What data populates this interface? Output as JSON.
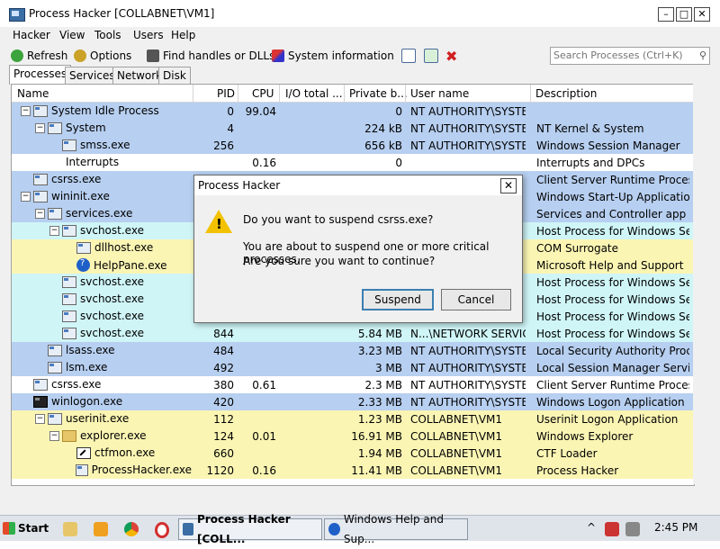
{
  "window": {
    "title": "Process Hacker [COLLABNET\\VM1]",
    "min": "–",
    "max": "□",
    "close": "✕"
  },
  "menu": [
    "Hacker",
    "View",
    "Tools",
    "Users",
    "Help"
  ],
  "toolbar": {
    "refresh": "Refresh",
    "options": "Options",
    "find": "Find handles or DLLs",
    "sysinfo": "System information"
  },
  "search": {
    "placeholder": "Search Processes (Ctrl+K)",
    "icon": "search-icon"
  },
  "tabs": [
    "Processes",
    "Services",
    "Network",
    "Disk"
  ],
  "columns": [
    "Name",
    "PID",
    "CPU",
    "I/O total ...",
    "Private b...",
    "User name",
    "Description"
  ],
  "colors": {
    "blue": "#b7cff0",
    "cyan": "#cff5f7",
    "yellow": "#fbf5b4",
    "white": "#ffffff",
    "accent": "#3c7fb1"
  },
  "processes": [
    {
      "indent": 0,
      "expander": "−",
      "icon": "process-icon",
      "name": "System Idle Process",
      "pid": "0",
      "cpu": "99.04",
      "io": "",
      "priv": "0",
      "user": "NT AUTHORITY\\SYSTEM",
      "desc": "",
      "color": "blue"
    },
    {
      "indent": 1,
      "expander": "−",
      "icon": "process-icon",
      "name": "System",
      "pid": "4",
      "cpu": "",
      "io": "",
      "priv": "224 kB",
      "user": "NT AUTHORITY\\SYSTEM",
      "desc": "NT Kernel & System",
      "color": "blue"
    },
    {
      "indent": 2,
      "expander": "",
      "icon": "process-icon",
      "name": "smss.exe",
      "pid": "256",
      "cpu": "",
      "io": "",
      "priv": "656 kB",
      "user": "NT AUTHORITY\\SYSTEM",
      "desc": "Windows Session Manager",
      "color": "blue"
    },
    {
      "indent": 1,
      "expander": "",
      "icon": "",
      "name": "Interrupts",
      "pid": "",
      "cpu": "0.16",
      "io": "",
      "priv": "0",
      "user": "",
      "desc": "Interrupts and DPCs",
      "color": "white"
    },
    {
      "indent": 0,
      "expander": "",
      "icon": "process-icon",
      "name": "csrss.exe",
      "pid": "",
      "cpu": "",
      "io": "",
      "priv": "",
      "user": "",
      "desc": "Client Server Runtime Process",
      "color": "blue"
    },
    {
      "indent": 0,
      "expander": "−",
      "icon": "process-icon",
      "name": "wininit.exe",
      "pid": "",
      "cpu": "",
      "io": "",
      "priv": "",
      "user": "",
      "desc": "Windows Start-Up Application",
      "color": "blue"
    },
    {
      "indent": 1,
      "expander": "−",
      "icon": "process-icon",
      "name": "services.exe",
      "pid": "",
      "cpu": "",
      "io": "",
      "priv": "",
      "user": "",
      "desc": "Services and Controller app",
      "color": "blue"
    },
    {
      "indent": 2,
      "expander": "−",
      "icon": "process-icon",
      "name": "svchost.exe",
      "pid": "",
      "cpu": "",
      "io": "",
      "priv": "",
      "user": "",
      "desc": "Host Process for Windows Ser...",
      "color": "cyan"
    },
    {
      "indent": 3,
      "expander": "",
      "icon": "process-icon",
      "name": "dllhost.exe",
      "pid": "",
      "cpu": "",
      "io": "",
      "priv": "",
      "user": "",
      "desc": "COM Surrogate",
      "color": "yellow"
    },
    {
      "indent": 3,
      "expander": "",
      "icon": "help-icon",
      "name": "HelpPane.exe",
      "pid": "",
      "cpu": "",
      "io": "",
      "priv": "",
      "user": "",
      "desc": "Microsoft Help and Support",
      "color": "yellow"
    },
    {
      "indent": 2,
      "expander": "",
      "icon": "process-icon",
      "name": "svchost.exe",
      "pid": "",
      "cpu": "",
      "io": "",
      "priv": "",
      "user": "",
      "desc": "Host Process for Windows Ser...",
      "color": "cyan"
    },
    {
      "indent": 2,
      "expander": "",
      "icon": "process-icon",
      "name": "svchost.exe",
      "pid": "",
      "cpu": "",
      "io": "",
      "priv": "",
      "user": "",
      "desc": "Host Process for Windows Ser...",
      "color": "cyan"
    },
    {
      "indent": 2,
      "expander": "",
      "icon": "process-icon",
      "name": "svchost.exe",
      "pid": "",
      "cpu": "",
      "io": "",
      "priv": "",
      "user": "",
      "desc": "Host Process for Windows Ser...",
      "color": "cyan"
    },
    {
      "indent": 2,
      "expander": "",
      "icon": "process-icon",
      "name": "svchost.exe",
      "pid": "844",
      "cpu": "",
      "io": "",
      "priv": "5.84 MB",
      "user": "N...\\NETWORK SERVICE",
      "desc": "Host Process for Windows Ser...",
      "color": "cyan"
    },
    {
      "indent": 1,
      "expander": "",
      "icon": "process-icon",
      "name": "lsass.exe",
      "pid": "484",
      "cpu": "",
      "io": "",
      "priv": "3.23 MB",
      "user": "NT AUTHORITY\\SYSTEM",
      "desc": "Local Security Authority Proce...",
      "color": "blue"
    },
    {
      "indent": 1,
      "expander": "",
      "icon": "process-icon",
      "name": "lsm.exe",
      "pid": "492",
      "cpu": "",
      "io": "",
      "priv": "3 MB",
      "user": "NT AUTHORITY\\SYSTEM",
      "desc": "Local Session Manager Service",
      "color": "blue"
    },
    {
      "indent": 0,
      "expander": "",
      "icon": "process-icon",
      "name": "csrss.exe",
      "pid": "380",
      "cpu": "0.61",
      "io": "",
      "priv": "2.3 MB",
      "user": "NT AUTHORITY\\SYSTEM",
      "desc": "Client Server Runtime Process",
      "color": "white"
    },
    {
      "indent": 0,
      "expander": "",
      "icon": "logon-icon",
      "name": "winlogon.exe",
      "pid": "420",
      "cpu": "",
      "io": "",
      "priv": "2.33 MB",
      "user": "NT AUTHORITY\\SYSTEM",
      "desc": "Windows Logon Application",
      "color": "blue"
    },
    {
      "indent": 1,
      "expander": "−",
      "icon": "process-icon",
      "name": "userinit.exe",
      "pid": "112",
      "cpu": "",
      "io": "",
      "priv": "1.23 MB",
      "user": "COLLABNET\\VM1",
      "desc": "Userinit Logon Application",
      "color": "yellow"
    },
    {
      "indent": 2,
      "expander": "−",
      "icon": "folder-icon",
      "name": "explorer.exe",
      "pid": "124",
      "cpu": "0.01",
      "io": "",
      "priv": "16.91 MB",
      "user": "COLLABNET\\VM1",
      "desc": "Windows Explorer",
      "color": "yellow"
    },
    {
      "indent": 3,
      "expander": "",
      "icon": "pen-icon",
      "name": "ctfmon.exe",
      "pid": "660",
      "cpu": "",
      "io": "",
      "priv": "1.94 MB",
      "user": "COLLABNET\\VM1",
      "desc": "CTF Loader",
      "color": "yellow"
    },
    {
      "indent": 3,
      "expander": "",
      "icon": "process-icon",
      "name": "ProcessHacker.exe",
      "pid": "1120",
      "cpu": "0.16",
      "io": "",
      "priv": "11.41 MB",
      "user": "COLLABNET\\VM1",
      "desc": "Process Hacker",
      "color": "yellow"
    }
  ],
  "dialog": {
    "title": "Process Hacker",
    "close": "✕",
    "question": "Do you want to suspend csrss.exe?",
    "line1": "You are about to suspend one or more critical processes.",
    "line2": "Are you sure you want to continue?",
    "suspend": "Suspend",
    "cancel": "Cancel"
  },
  "taskbar": {
    "start": "Start",
    "tasks": [
      "Process Hacker [COLL...",
      "Windows Help and Sup..."
    ],
    "clock": "2:45 PM"
  }
}
